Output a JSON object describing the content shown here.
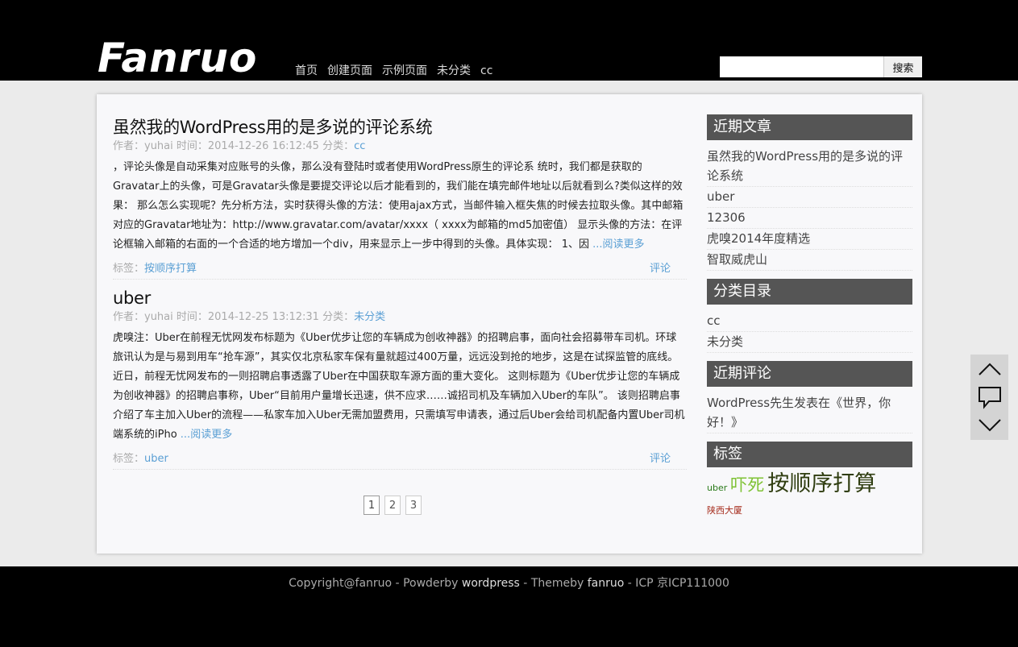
{
  "logo": "Fanruo",
  "nav": [
    "首页",
    "创建页面",
    "示例页面",
    "未分类",
    "cc"
  ],
  "search": {
    "value": "",
    "button": "搜索"
  },
  "posts": [
    {
      "title": "虽然我的WordPress用的是多说的评论系统",
      "meta_prefix": "作者：yuhai 时间：2014-12-26 16:12:45 分类：",
      "category": "cc",
      "body": "，评论头像是自动采集对应账号的头像，那么没有登陆时或者使用WordPress原生的评论系 统时，我们都是获取的Gravatar上的头像，可是Gravatar头像是要提交评论以后才能看到的，我们能在填完邮件地址以后就看到么?类似这样的效 果： 那么怎么实现呢？先分析方法，实时获得头像的方法：使用ajax方式，当邮件输入框失焦的时候去拉取头像。其中邮箱对应的Gravatar地址为：http://www.gravatar.com/avatar/xxxx（ xxxx为邮箱的md5加密值） 显示头像的方法：在评论框输入邮箱的右面的一个合适的地方增加一个div，用来显示上一步中得到的头像。具体实现： 1、因",
      "read_more": "...阅读更多",
      "tags_label": "标签：",
      "tags": "按顺序打算",
      "comment": "评论"
    },
    {
      "title": "uber",
      "meta_prefix": "作者：yuhai 时间：2014-12-25 13:12:31 分类：",
      "category": "未分类",
      "body": "虎嗅注：Uber在前程无忧网发布标题为《Uber优步让您的车辆成为创收神器》的招聘启事，面向社会招募带车司机。环球旅讯认为是与易到用车“抢车源”，其实仅北京私家车保有量就超过400万量，远远没到抢的地步，这是在试探监管的底线。 近日，前程无忧网发布的一则招聘启事透露了Uber在中国获取车源方面的重大变化。 这则标题为《Uber优步让您的车辆成为创收神器》的招聘启事称，Uber“目前用户量增长迅速，供不应求……诚招司机及车辆加入Uber的车队”。 该则招聘启事介绍了车主加入Uber的流程——私家车加入Uber无需加盟费用，只需填写申请表，通过后Uber会给司机配备内置Uber司机端系统的iPho",
      "read_more": "...阅读更多",
      "tags_label": "标签：",
      "tags": "uber",
      "comment": "评论"
    }
  ],
  "pagination": [
    "1",
    "2",
    "3"
  ],
  "sidebar": {
    "recent_posts": {
      "title": "近期文章",
      "items": [
        "虽然我的WordPress用的是多说的评论系统",
        "uber",
        "12306",
        "虎嗅2014年度精选",
        "智取威虎山"
      ]
    },
    "categories": {
      "title": "分类目录",
      "items": [
        "cc",
        "未分类"
      ]
    },
    "recent_comments": {
      "title": "近期评论",
      "author": "WordPress先生",
      "on": "发表在",
      "post": "《世界，你好！》"
    },
    "tags": {
      "title": "标签",
      "items": [
        {
          "text": "uber",
          "color": "#2a7a1a"
        },
        {
          "text": "吓死",
          "color": "#7ec234"
        },
        {
          "text": "按顺序打算",
          "color": "#2f3d10"
        },
        {
          "text": "陕西大厦",
          "color": "#a52a1a"
        }
      ]
    }
  },
  "side_tools": [
    "chevron-up-icon",
    "comment-icon",
    "chevron-down-icon"
  ],
  "footer": {
    "copyright": "Copyright@fanruo",
    "sep1": " - ",
    "powder_label": "Powderby ",
    "powder": "wordpress",
    "sep2": " - ",
    "theme_label": "Themeby ",
    "theme": "fanruo",
    "sep3": " - ",
    "icp": "ICP 京ICP111000"
  }
}
